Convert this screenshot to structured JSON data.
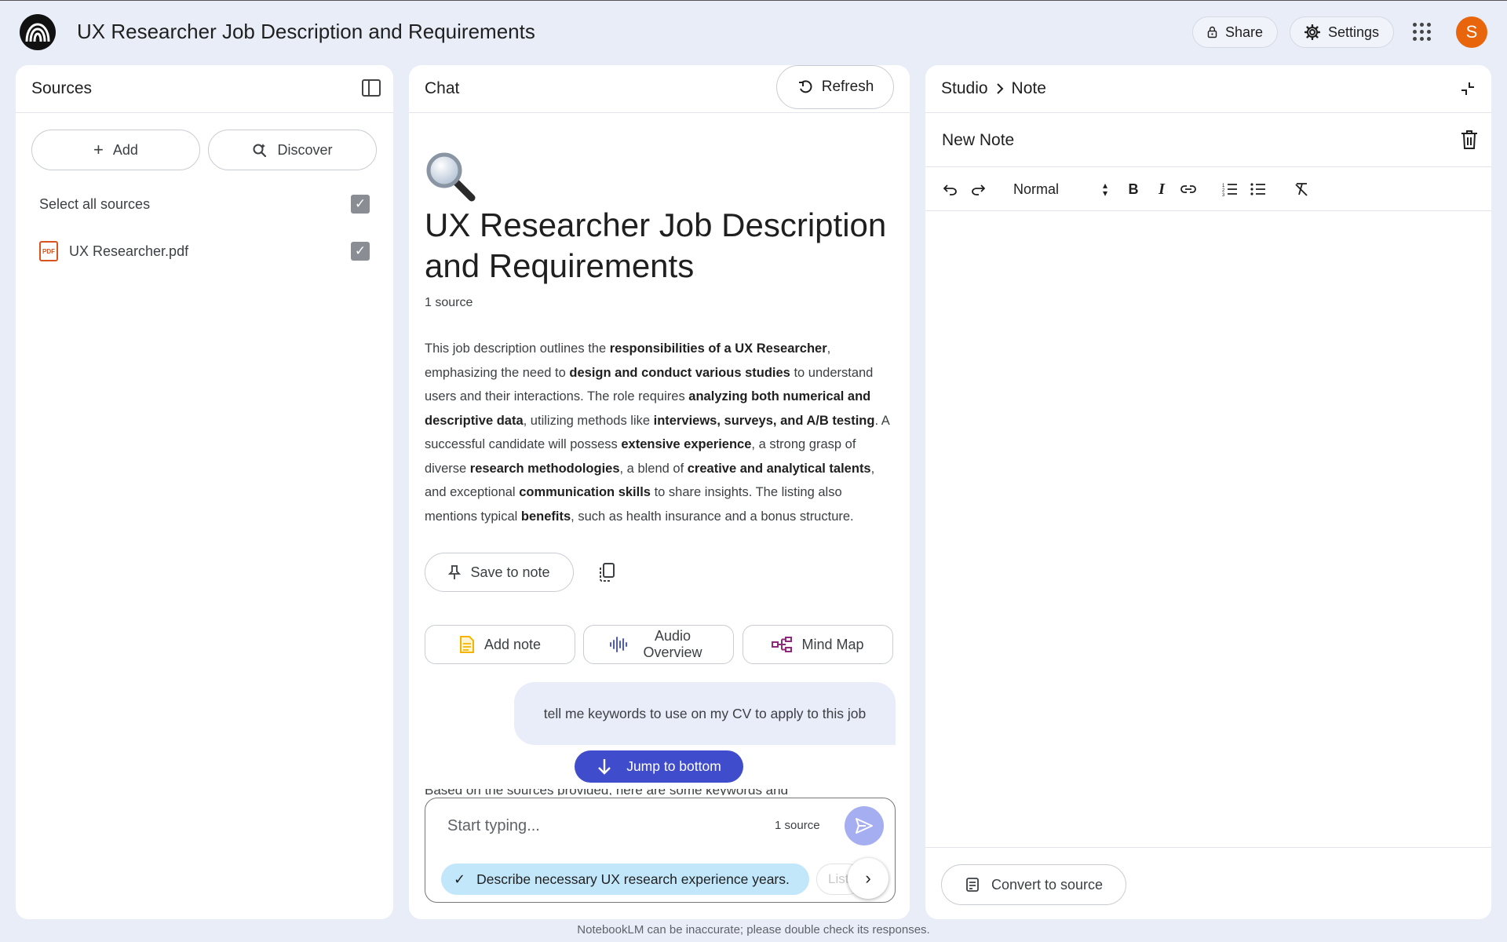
{
  "header": {
    "title": "UX Researcher Job Description and Requirements",
    "share_label": "Share",
    "settings_label": "Settings",
    "avatar_letter": "S"
  },
  "sources": {
    "title": "Sources",
    "add_label": "Add",
    "discover_label": "Discover",
    "select_all_label": "Select all sources",
    "items": [
      {
        "name": "UX Researcher.pdf",
        "type_label": "PDF"
      }
    ]
  },
  "chat": {
    "title": "Chat",
    "refresh_label": "Refresh",
    "doc_title": "UX Researcher Job Description and Requirements",
    "source_count": "1 source",
    "summary_parts": [
      {
        "text": "This job description outlines the "
      },
      {
        "text": "responsibilities of a UX Researcher",
        "bold": true
      },
      {
        "text": ", emphasizing the need to "
      },
      {
        "text": "design and conduct various studies",
        "bold": true
      },
      {
        "text": " to understand users and their interactions. The role requires "
      },
      {
        "text": "analyzing both numerical and descriptive data",
        "bold": true
      },
      {
        "text": ", utilizing methods like "
      },
      {
        "text": "interviews, surveys, and A/B testing",
        "bold": true
      },
      {
        "text": ". A successful candidate will possess "
      },
      {
        "text": "extensive experience",
        "bold": true
      },
      {
        "text": ", a strong grasp of diverse "
      },
      {
        "text": "research methodologies",
        "bold": true
      },
      {
        "text": ", a blend of "
      },
      {
        "text": "creative and analytical talents",
        "bold": true
      },
      {
        "text": ", and exceptional "
      },
      {
        "text": "communication skills",
        "bold": true
      },
      {
        "text": " to share insights. The listing also mentions typical "
      },
      {
        "text": "benefits",
        "bold": true
      },
      {
        "text": ", such as health insurance and a bonus structure."
      }
    ],
    "save_to_note_label": "Save to note",
    "add_note_label": "Add note",
    "audio_overview_label": "Audio Overview",
    "mind_map_label": "Mind Map",
    "user_message": "tell me keywords to use on my CV to apply to this job",
    "jump_label": "Jump to bottom",
    "partial_response": "Based on the sources provided, here are some keywords and",
    "input_placeholder": "Start typing...",
    "input_source_count": "1 source",
    "suggestion_1": "Describe necessary UX research experience years.",
    "suggestion_2": "List"
  },
  "studio": {
    "crumb_root": "Studio",
    "crumb_current": "Note",
    "note_title": "New Note",
    "format_select": "Normal",
    "convert_label": "Convert to source"
  },
  "footer": {
    "disclaimer": "NotebookLM can be inaccurate; please double check its responses."
  },
  "colors": {
    "background": "#e9edf8",
    "jump_button": "#3f4ccc",
    "send_button": "#a6aef2",
    "suggestion_chip": "#c2e7fb",
    "avatar": "#e8650c"
  }
}
